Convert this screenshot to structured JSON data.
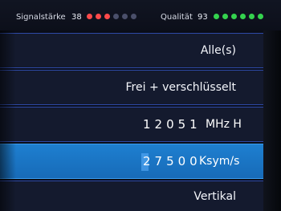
{
  "status": {
    "signal_label": "Signalstärke",
    "signal_value": "38",
    "signal_dots": [
      "#ff4a4a",
      "#ff4a4a",
      "#ff4a4a",
      "#4a4f6a",
      "#4a4f6a",
      "#4a4f6a"
    ],
    "quality_label": "Qualität",
    "quality_value": "93",
    "quality_dots": [
      "#34d34e",
      "#34d34e",
      "#34d34e",
      "#34d34e",
      "#34d34e",
      "#34d34e"
    ]
  },
  "rows": {
    "satellite": "Alle(s)",
    "encryption": "Frei + verschlüsselt",
    "frequency_value": "12051",
    "frequency_unit": "MHz H",
    "symbolrate_value": "27500",
    "symbolrate_unit": "Ksym/s",
    "polarization": "Vertikal"
  },
  "colors": {
    "selected_row": "#1e7fd0",
    "row_border": "#2e4aa8"
  }
}
